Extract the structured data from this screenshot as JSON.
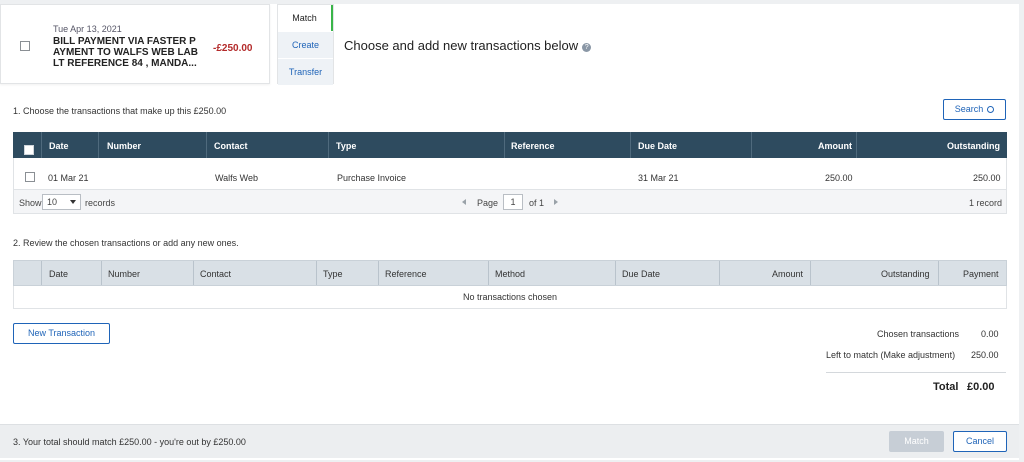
{
  "statement": {
    "date": "Tue Apr 13, 2021",
    "description": "BILL PAYMENT VIA FASTER P AYMENT TO WALFS WEB LAB LT REFERENCE 84 , MANDA...",
    "amount": "-£250.00"
  },
  "tabs": [
    {
      "label": "Match",
      "active": true
    },
    {
      "label": "Create",
      "active": false
    },
    {
      "label": "Transfer",
      "active": false
    }
  ],
  "heading": "Choose and add new transactions below",
  "help_icon": "question-circle-icon",
  "section1": {
    "label": "1. Choose the transactions that make up this £250.00",
    "search_label": "Search",
    "columns": [
      "Date",
      "Number",
      "Contact",
      "Type",
      "Reference",
      "Due Date",
      "Amount",
      "Outstanding"
    ],
    "rows": [
      {
        "date": "01 Mar 21",
        "number": "",
        "contact": "Walfs Web",
        "type": "Purchase Invoice",
        "reference": "",
        "due_date": "31 Mar 21",
        "amount": "250.00",
        "outstanding": "250.00"
      }
    ],
    "footer": {
      "show_label": "Show",
      "page_size": "10",
      "records_label": "records",
      "page_label": "Page",
      "page_value": "1",
      "of_label": "of 1",
      "count_label": "1 record"
    }
  },
  "section2": {
    "label": "2. Review the chosen transactions or add any new ones.",
    "columns": [
      "Date",
      "Number",
      "Contact",
      "Type",
      "Reference",
      "Method",
      "Due Date",
      "Amount",
      "Outstanding",
      "Payment"
    ],
    "empty_text": "No transactions chosen",
    "new_transaction_label": "New Transaction"
  },
  "summary": {
    "chosen_label": "Chosen transactions",
    "chosen_value": "0.00",
    "left_label_prefix": "Left to match (",
    "adjustment_link": "Make adjustment",
    "left_label_suffix": ")",
    "left_value": "250.00",
    "total_label": "Total",
    "total_value": "£0.00"
  },
  "bottom": {
    "message": "3. Your total should match £250.00 - you're out by £250.00",
    "match_label": "Match",
    "cancel_label": "Cancel"
  },
  "colors": {
    "accent": "#1f64b8",
    "negative": "#b32a2a",
    "header_dark": "#2e4b5f",
    "active_tab_marker": "#39b549"
  }
}
